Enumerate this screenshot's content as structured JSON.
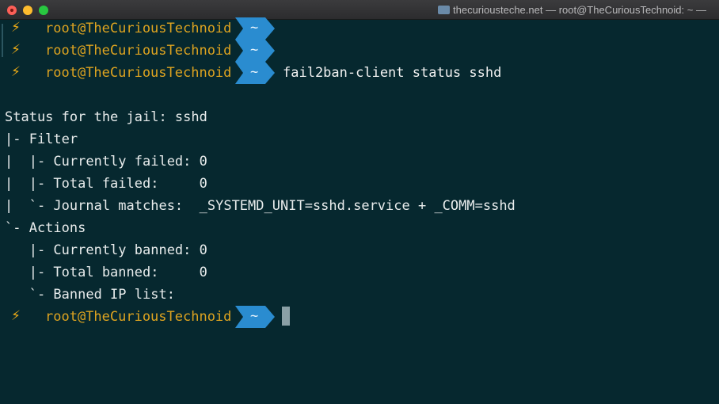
{
  "window": {
    "title": "thecuriousteche.net — root@TheCuriousTechnoid: ~ —"
  },
  "prompt": {
    "icon": "lightning-bolt-icon",
    "bolt": "⚡",
    "user": "root@TheCuriousTechnoid",
    "dir": "~"
  },
  "command": "fail2ban-client status sshd",
  "output": [
    "Status for the jail: sshd",
    "|- Filter",
    "|  |- Currently failed: 0",
    "|  |- Total failed:     0",
    "|  `- Journal matches:  _SYSTEMD_UNIT=sshd.service + _COMM=sshd",
    "`- Actions",
    "   |- Currently banned: 0",
    "   |- Total banned:     0",
    "   `- Banned IP list:"
  ],
  "colors": {
    "background": "#06282f",
    "prompt_user": "#dda320",
    "dir_segment": "#2a8cd0",
    "text": "#e8ecec"
  }
}
